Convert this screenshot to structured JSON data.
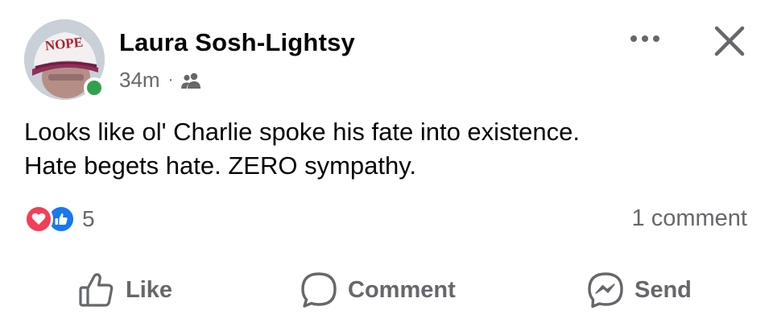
{
  "post": {
    "author": {
      "name": "Laura Sosh-Lightsy",
      "avatar_hat_text": "NOPE",
      "online": true
    },
    "meta": {
      "timestamp": "34m",
      "separator": "·",
      "audience_icon": "friends-icon"
    },
    "header_actions": {
      "more_icon": "more-options-icon",
      "close_icon": "close-icon"
    },
    "text": {
      "line1": "Looks like ol' Charlie spoke his fate into existence.",
      "line2": "Hate begets hate. ZERO sympathy."
    },
    "reactions": {
      "types": [
        "love",
        "like"
      ],
      "count": "5"
    },
    "comments": {
      "label": "1 comment"
    },
    "actions": {
      "like": "Like",
      "comment": "Comment",
      "send": "Send"
    }
  },
  "colors": {
    "text_primary": "#050505",
    "text_secondary": "#65676b",
    "online_green": "#31a24c",
    "love_red": "#f33e58",
    "like_blue": "#1877f2"
  }
}
